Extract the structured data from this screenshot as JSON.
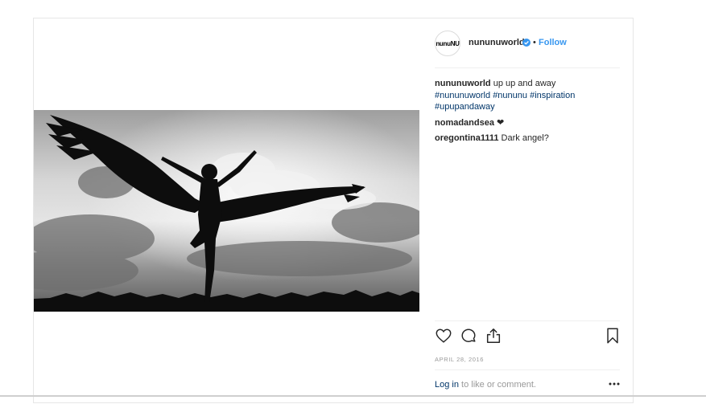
{
  "account": {
    "avatar_text": "nunuNU",
    "username": "nununuworld",
    "separator": "•",
    "follow_label": "Follow"
  },
  "caption": {
    "user": "nununuworld",
    "text": " up up and away",
    "hashtags": [
      "#nununuworld",
      "#nununu",
      "#inspiration",
      "#upupandaway"
    ]
  },
  "comments": [
    {
      "user": "nomadandsea",
      "text": " ❤"
    },
    {
      "user": "oregontina1111",
      "text": " Dark angel?"
    }
  ],
  "actions": {
    "like_icon": "heart-icon",
    "comment_icon": "comment-icon",
    "share_icon": "share-icon",
    "save_icon": "bookmark-icon"
  },
  "date": "APRIL 28, 2016",
  "login": {
    "link": "Log in",
    "text": " to like or comment."
  },
  "colors": {
    "link_blue": "#3897f0",
    "hashtag": "#003569",
    "muted": "#999999"
  }
}
